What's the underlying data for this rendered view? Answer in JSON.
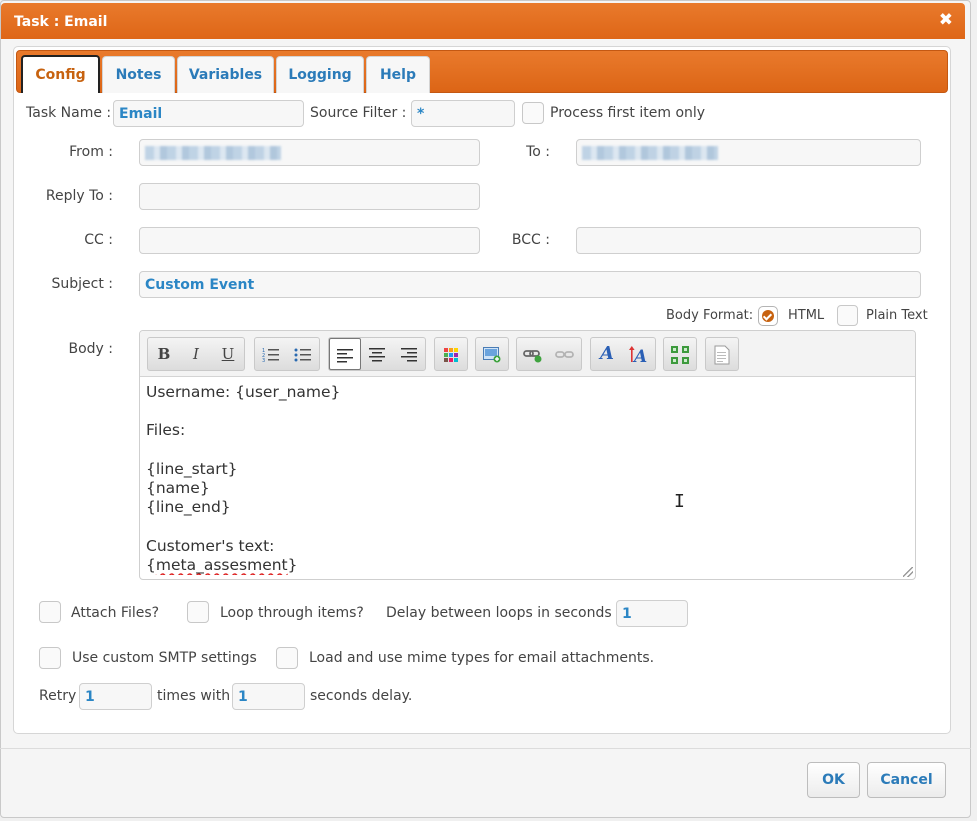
{
  "dialog": {
    "title": "Task : Email",
    "close_symbol": "✖",
    "accent_color": "#de6617"
  },
  "tabs": [
    {
      "label": "Config",
      "active": true
    },
    {
      "label": "Notes",
      "active": false
    },
    {
      "label": "Variables",
      "active": false
    },
    {
      "label": "Logging",
      "active": false
    },
    {
      "label": "Help",
      "active": false
    }
  ],
  "form": {
    "task_name_label": "Task Name :",
    "task_name_value": "Email",
    "source_filter_label": "Source Filter :",
    "source_filter_value": "*",
    "process_first_label": "Process first item only",
    "process_first_checked": false,
    "from_label": "From :",
    "from_value_redacted": true,
    "to_label": "To :",
    "to_value_redacted": true,
    "reply_to_label": "Reply To :",
    "reply_to_value": "",
    "cc_label": "CC :",
    "cc_value": "",
    "bcc_label": "BCC :",
    "bcc_value": "",
    "subject_label": "Subject :",
    "subject_value": "Custom Event",
    "body_format_label": "Body Format:",
    "body_format_html_label": "HTML",
    "body_format_plain_label": "Plain Text",
    "body_format_selected": "HTML",
    "body_label": "Body :"
  },
  "editor": {
    "toolbar_icons": [
      "bold-icon",
      "italic-icon",
      "underline-icon",
      "numbered-list-icon",
      "bullet-list-icon",
      "align-left-icon",
      "align-center-icon",
      "align-right-icon",
      "color-palette-icon",
      "insert-image-icon",
      "insert-link-icon",
      "remove-link-icon",
      "font-style-icon",
      "font-size-icon",
      "fullscreen-icon",
      "source-view-icon"
    ],
    "bold_glyph": "B",
    "italic_glyph": "I",
    "underline_glyph": "U",
    "body_lines": [
      "Username: {user_name}",
      "",
      "Files:",
      "",
      "{line_start}",
      "{name}",
      "{line_end}",
      "",
      "Customer's text:"
    ],
    "last_line_prefix": "{",
    "last_line_misspelled": "meta_assesment",
    "last_line_suffix": "}"
  },
  "options": {
    "attach_files_label": "Attach Files?",
    "attach_files_checked": false,
    "loop_items_label": "Loop through items?",
    "loop_items_checked": false,
    "delay_label": "Delay between loops in seconds :",
    "delay_value": "1",
    "custom_smtp_label": "Use custom SMTP settings",
    "custom_smtp_checked": false,
    "mime_types_label": "Load and use mime types for email attachments.",
    "mime_types_checked": false,
    "retry_label": "Retry",
    "retry_value": "1",
    "times_with_label": "times with",
    "seconds_value": "1",
    "seconds_delay_label": "seconds delay."
  },
  "footer": {
    "ok_label": "OK",
    "cancel_label": "Cancel"
  }
}
